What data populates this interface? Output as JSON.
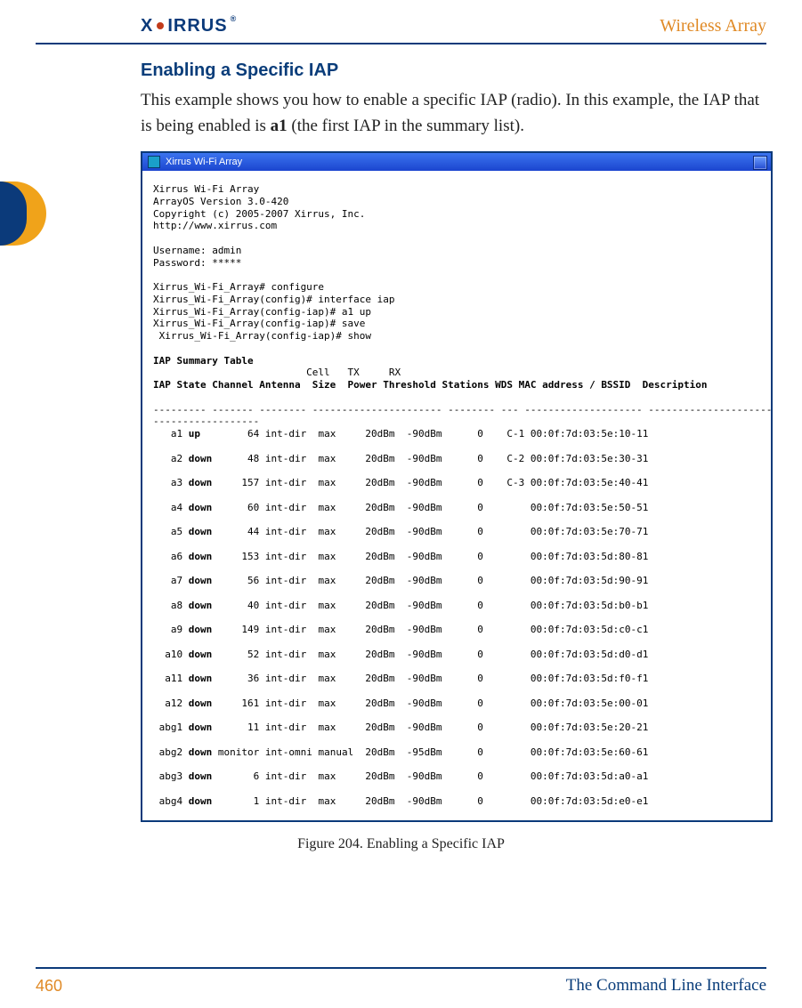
{
  "header": {
    "brand_text": "XIRRUS",
    "brand_reg": "®",
    "doc_title": "Wireless Array"
  },
  "section": {
    "title": "Enabling a Specific IAP",
    "body_prefix": "This example shows you how to enable a specific IAP (radio). In this example, the IAP that is being enabled is ",
    "body_bold": "a1",
    "body_suffix": " (the first IAP in the summary list)."
  },
  "window": {
    "title": "Xirrus Wi-Fi Array"
  },
  "cli": {
    "banner": [
      "Xirrus Wi-Fi Array",
      "ArrayOS Version 3.0-420",
      "Copyright (c) 2005-2007 Xirrus, Inc.",
      "http://www.xirrus.com"
    ],
    "creds": [
      "Username: admin",
      "Password: *****"
    ],
    "commands": [
      "Xirrus_Wi-Fi_Array# configure",
      "Xirrus_Wi-Fi_Array(config)# interface iap",
      "Xirrus_Wi-Fi_Array(config-iap)# a1 up",
      "Xirrus_Wi-Fi_Array(config-iap)# save",
      " Xirrus_Wi-Fi_Array(config-iap)# show"
    ],
    "table_title": "IAP Summary Table",
    "group_headers_line": "                          Cell   TX     RX",
    "columns_line": "IAP State Channel Antenna  Size  Power Threshold Stations WDS MAC address / BSSID  Description",
    "rule_line": "--------- ------- -------- ---------------------- -------- --- -------------------- -----------------------\n------------------",
    "prompt_end": "Xirrus_Wi-Fi_Array(config-iap)#"
  },
  "iap_rows": [
    {
      "iap": "a1",
      "state": "up",
      "channel": "64",
      "antenna": "int-dir",
      "size": "max",
      "tx": "20dBm",
      "rx": "-90dBm",
      "stations": "0",
      "wds": "C-1",
      "mac": "00:0f:7d:03:5e:10-11"
    },
    {
      "iap": "a2",
      "state": "down",
      "channel": "48",
      "antenna": "int-dir",
      "size": "max",
      "tx": "20dBm",
      "rx": "-90dBm",
      "stations": "0",
      "wds": "C-2",
      "mac": "00:0f:7d:03:5e:30-31"
    },
    {
      "iap": "a3",
      "state": "down",
      "channel": "157",
      "antenna": "int-dir",
      "size": "max",
      "tx": "20dBm",
      "rx": "-90dBm",
      "stations": "0",
      "wds": "C-3",
      "mac": "00:0f:7d:03:5e:40-41"
    },
    {
      "iap": "a4",
      "state": "down",
      "channel": "60",
      "antenna": "int-dir",
      "size": "max",
      "tx": "20dBm",
      "rx": "-90dBm",
      "stations": "0",
      "wds": "",
      "mac": "00:0f:7d:03:5e:50-51"
    },
    {
      "iap": "a5",
      "state": "down",
      "channel": "44",
      "antenna": "int-dir",
      "size": "max",
      "tx": "20dBm",
      "rx": "-90dBm",
      "stations": "0",
      "wds": "",
      "mac": "00:0f:7d:03:5e:70-71"
    },
    {
      "iap": "a6",
      "state": "down",
      "channel": "153",
      "antenna": "int-dir",
      "size": "max",
      "tx": "20dBm",
      "rx": "-90dBm",
      "stations": "0",
      "wds": "",
      "mac": "00:0f:7d:03:5d:80-81"
    },
    {
      "iap": "a7",
      "state": "down",
      "channel": "56",
      "antenna": "int-dir",
      "size": "max",
      "tx": "20dBm",
      "rx": "-90dBm",
      "stations": "0",
      "wds": "",
      "mac": "00:0f:7d:03:5d:90-91"
    },
    {
      "iap": "a8",
      "state": "down",
      "channel": "40",
      "antenna": "int-dir",
      "size": "max",
      "tx": "20dBm",
      "rx": "-90dBm",
      "stations": "0",
      "wds": "",
      "mac": "00:0f:7d:03:5d:b0-b1"
    },
    {
      "iap": "a9",
      "state": "down",
      "channel": "149",
      "antenna": "int-dir",
      "size": "max",
      "tx": "20dBm",
      "rx": "-90dBm",
      "stations": "0",
      "wds": "",
      "mac": "00:0f:7d:03:5d:c0-c1"
    },
    {
      "iap": "a10",
      "state": "down",
      "channel": "52",
      "antenna": "int-dir",
      "size": "max",
      "tx": "20dBm",
      "rx": "-90dBm",
      "stations": "0",
      "wds": "",
      "mac": "00:0f:7d:03:5d:d0-d1"
    },
    {
      "iap": "a11",
      "state": "down",
      "channel": "36",
      "antenna": "int-dir",
      "size": "max",
      "tx": "20dBm",
      "rx": "-90dBm",
      "stations": "0",
      "wds": "",
      "mac": "00:0f:7d:03:5d:f0-f1"
    },
    {
      "iap": "a12",
      "state": "down",
      "channel": "161",
      "antenna": "int-dir",
      "size": "max",
      "tx": "20dBm",
      "rx": "-90dBm",
      "stations": "0",
      "wds": "",
      "mac": "00:0f:7d:03:5e:00-01"
    },
    {
      "iap": "abg1",
      "state": "down",
      "channel": "11",
      "antenna": "int-dir",
      "size": "max",
      "tx": "20dBm",
      "rx": "-90dBm",
      "stations": "0",
      "wds": "",
      "mac": "00:0f:7d:03:5e:20-21"
    },
    {
      "iap": "abg2",
      "state": "down",
      "channel": "monitor",
      "antenna": "int-omni",
      "size": "manual",
      "tx": "20dBm",
      "rx": "-95dBm",
      "stations": "0",
      "wds": "",
      "mac": "00:0f:7d:03:5e:60-61"
    },
    {
      "iap": "abg3",
      "state": "down",
      "channel": "6",
      "antenna": "int-dir",
      "size": "max",
      "tx": "20dBm",
      "rx": "-90dBm",
      "stations": "0",
      "wds": "",
      "mac": "00:0f:7d:03:5d:a0-a1"
    },
    {
      "iap": "abg4",
      "state": "down",
      "channel": "1",
      "antenna": "int-dir",
      "size": "max",
      "tx": "20dBm",
      "rx": "-90dBm",
      "stations": "0",
      "wds": "",
      "mac": "00:0f:7d:03:5d:e0-e1"
    }
  ],
  "figure": {
    "caption": "Figure 204. Enabling a Specific IAP"
  },
  "footer": {
    "page": "460",
    "section": "The Command Line Interface"
  }
}
